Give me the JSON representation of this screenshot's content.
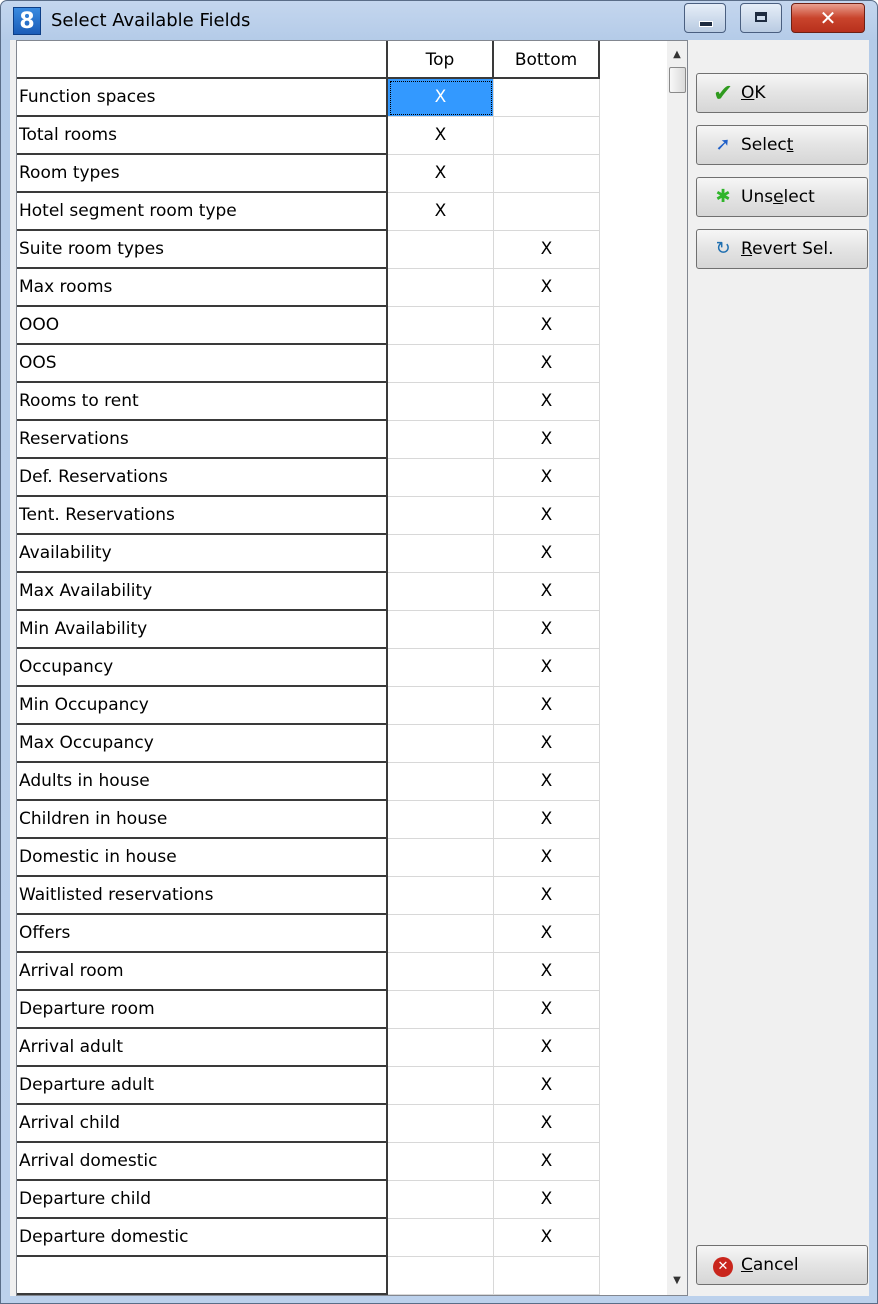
{
  "window": {
    "app_icon": "8",
    "title": "Select Available Fields",
    "minimize_icon": "minimize-icon",
    "maximize_icon": "maximize-icon",
    "close_glyph": "✕"
  },
  "grid": {
    "columns": {
      "name": "",
      "top": "Top",
      "bottom": "Bottom"
    },
    "rows": [
      {
        "name": "Function spaces",
        "top": "X",
        "bottom": ""
      },
      {
        "name": "Total rooms",
        "top": "X",
        "bottom": ""
      },
      {
        "name": "Room types",
        "top": "X",
        "bottom": ""
      },
      {
        "name": "Hotel segment room type",
        "top": "X",
        "bottom": ""
      },
      {
        "name": "Suite room types",
        "top": "",
        "bottom": "X"
      },
      {
        "name": "Max rooms",
        "top": "",
        "bottom": "X"
      },
      {
        "name": "OOO",
        "top": "",
        "bottom": "X"
      },
      {
        "name": "OOS",
        "top": "",
        "bottom": "X"
      },
      {
        "name": "Rooms to rent",
        "top": "",
        "bottom": "X"
      },
      {
        "name": "Reservations",
        "top": "",
        "bottom": "X"
      },
      {
        "name": "Def. Reservations",
        "top": "",
        "bottom": "X"
      },
      {
        "name": "Tent. Reservations",
        "top": "",
        "bottom": "X"
      },
      {
        "name": "Availability",
        "top": "",
        "bottom": "X"
      },
      {
        "name": "Max Availability",
        "top": "",
        "bottom": "X"
      },
      {
        "name": "Min Availability",
        "top": "",
        "bottom": "X"
      },
      {
        "name": "Occupancy",
        "top": "",
        "bottom": "X"
      },
      {
        "name": "Min Occupancy",
        "top": "",
        "bottom": "X"
      },
      {
        "name": "Max Occupancy",
        "top": "",
        "bottom": "X"
      },
      {
        "name": "Adults in house",
        "top": "",
        "bottom": "X"
      },
      {
        "name": "Children in house",
        "top": "",
        "bottom": "X"
      },
      {
        "name": "Domestic in house",
        "top": "",
        "bottom": "X"
      },
      {
        "name": "Waitlisted reservations",
        "top": "",
        "bottom": "X"
      },
      {
        "name": "Offers",
        "top": "",
        "bottom": "X"
      },
      {
        "name": "Arrival room",
        "top": "",
        "bottom": "X"
      },
      {
        "name": "Departure room",
        "top": "",
        "bottom": "X"
      },
      {
        "name": "Arrival adult",
        "top": "",
        "bottom": "X"
      },
      {
        "name": "Departure adult",
        "top": "",
        "bottom": "X"
      },
      {
        "name": "Arrival child",
        "top": "",
        "bottom": "X"
      },
      {
        "name": "Arrival domestic",
        "top": "",
        "bottom": "X"
      },
      {
        "name": "Departure child",
        "top": "",
        "bottom": "X"
      },
      {
        "name": "Departure domestic",
        "top": "",
        "bottom": "X"
      },
      {
        "name": "",
        "top": "",
        "bottom": ""
      }
    ]
  },
  "buttons": {
    "ok": {
      "pre": "",
      "key": "O",
      "post": "K",
      "icon": "checkmark-icon"
    },
    "select": {
      "pre": "Selec",
      "key": "t",
      "post": "",
      "icon": "cursor-arrow-icon"
    },
    "unselect": {
      "pre": "Uns",
      "key": "e",
      "post": "lect",
      "icon": "unselect-icon"
    },
    "revert": {
      "pre": "",
      "key": "R",
      "post": "evert Sel.",
      "icon": "revert-icon"
    },
    "cancel": {
      "pre": "",
      "key": "C",
      "post": "ancel",
      "icon": "cancel-icon"
    }
  },
  "colors": {
    "selection": "#3399ff",
    "title_bar": "#c4d6ee",
    "close_button": "#c9442c"
  }
}
